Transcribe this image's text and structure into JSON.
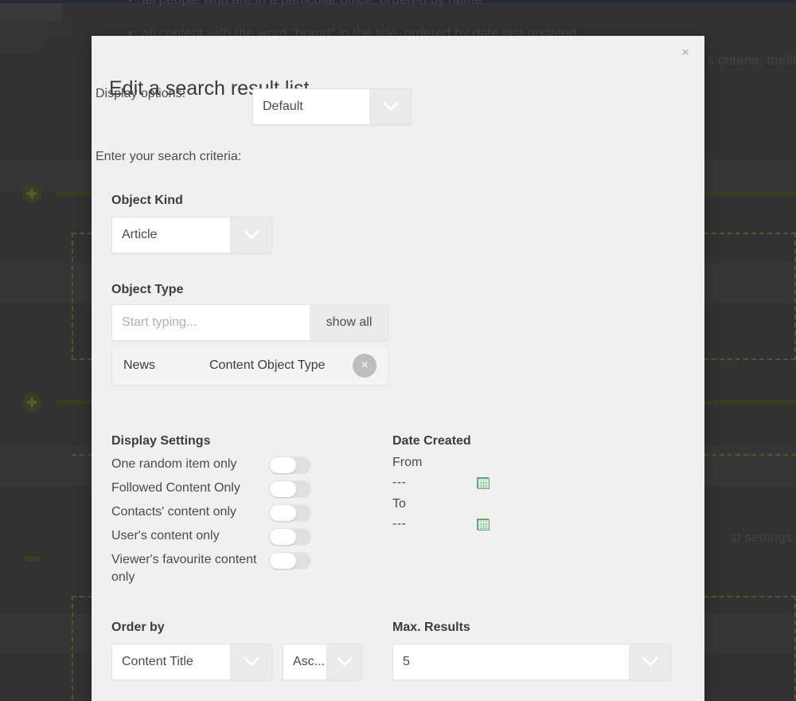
{
  "background": {
    "bullets": [
      "all people who are in a particular office, ordered by name",
      "all content with the word \"brand\" in the title, ordered by date last updated"
    ],
    "right_text_1": "s criteria, thefil",
    "right_text_2": "st settings.",
    "accent_green": "#4b5423"
  },
  "modal": {
    "title": "Edit a search result list",
    "close_label": "×",
    "display_options_label": "Display options:",
    "display_options_value": "Default",
    "criteria_label": "Enter your search criteria:",
    "object_kind": {
      "label": "Object Kind",
      "value": "Article"
    },
    "object_type": {
      "label": "Object Type",
      "input_value": "",
      "input_placeholder": "Start typing...",
      "show_all_label": "show all",
      "selected": {
        "name": "News",
        "type": "Content Object Type",
        "remove_label": "×"
      }
    },
    "display_settings": {
      "label": "Display Settings",
      "items": [
        {
          "label": "One random item only",
          "on": false
        },
        {
          "label": "Followed Content Only",
          "on": false
        },
        {
          "label": "Contacts' content only",
          "on": false
        },
        {
          "label": "User's content only",
          "on": false
        },
        {
          "label": "Viewer's favourite content only",
          "on": false
        }
      ]
    },
    "date_created": {
      "label": "Date Created",
      "from_label": "From",
      "from_value": "---",
      "to_label": "To",
      "to_value": "---"
    },
    "order_by": {
      "label": "Order by",
      "field_value": "Content Title",
      "direction_value": "Asc..."
    },
    "max_results": {
      "label": "Max. Results",
      "value": "5"
    }
  }
}
